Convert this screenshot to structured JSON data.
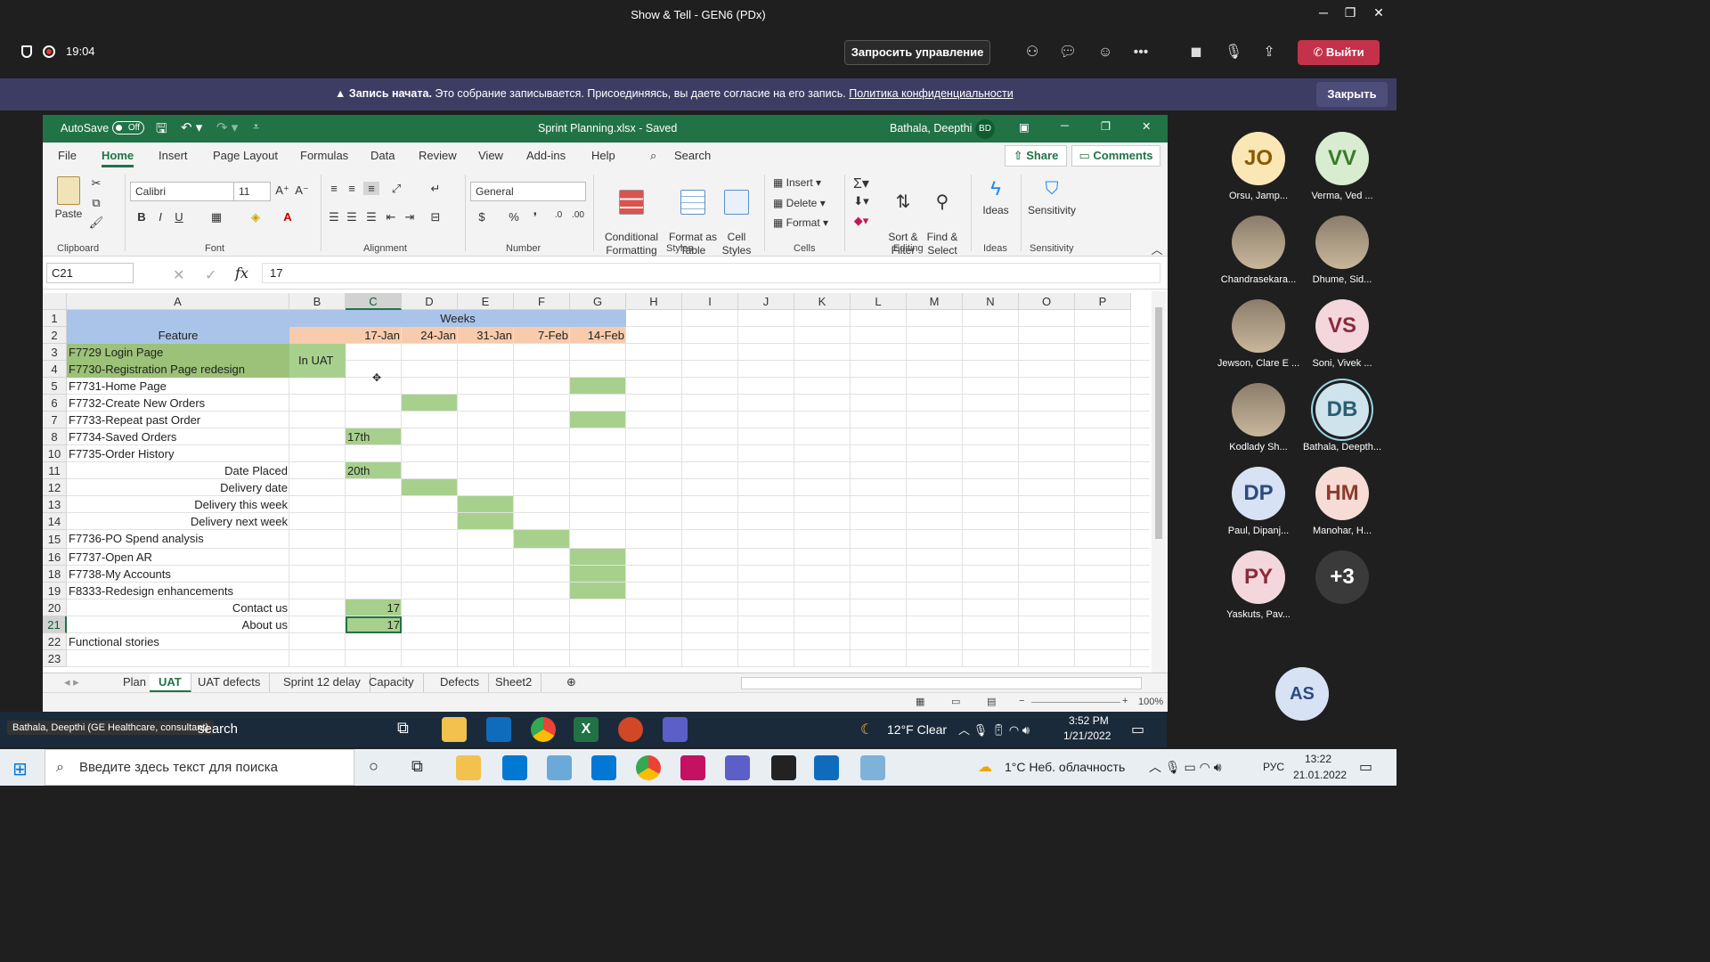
{
  "teams": {
    "meeting_title": "Show & Tell - GEN6 (PDx)",
    "timer": "19:04",
    "request_control": "Запросить управление",
    "leave": "Выйти",
    "notice_bold": "Запись начата.",
    "notice_text": "Это собрание записывается. Присоединяясь, вы даете согласие на его запись.",
    "notice_link": "Политика конфиденциальности",
    "notice_close": "Закрыть",
    "presenter_label": "Bathala, Deepthi (GE Healthcare, consultant)"
  },
  "excel": {
    "autosave": "AutoSave",
    "autosave_state": "Off",
    "file_title": "Sprint Planning.xlsx  -  Saved",
    "user_name": "Bathala, Deepthi",
    "user_initials": "BD",
    "tabs": [
      "File",
      "Home",
      "Insert",
      "Page Layout",
      "Formulas",
      "Data",
      "Review",
      "View",
      "Add-ins",
      "Help"
    ],
    "active_tab": "Home",
    "search": "Search",
    "share": "Share",
    "comments": "Comments",
    "ribbon": {
      "paste": "Paste",
      "clipboard": "Clipboard",
      "font_name": "Calibri",
      "font_size": "11",
      "font": "Font",
      "alignment": "Alignment",
      "number_format": "General",
      "number": "Number",
      "conditional_formatting": "Conditional\nFormatting",
      "format_as_table": "Format as\nTable",
      "cell_styles": "Cell\nStyles",
      "styles": "Styles",
      "insert": "Insert",
      "delete": "Delete",
      "format": "Format",
      "cells": "Cells",
      "sort_filter": "Sort &\nFilter",
      "find_select": "Find &\nSelect",
      "editing": "Editing",
      "ideas": "Ideas",
      "ideas_group": "Ideas",
      "sensitivity": "Sensitivity",
      "sensitivity_group": "Sensitivity"
    },
    "name_box": "C21",
    "formula_value": "17",
    "columns": [
      "A",
      "B",
      "C",
      "D",
      "E",
      "F",
      "G",
      "H",
      "I",
      "J",
      "K",
      "L",
      "M",
      "N",
      "O",
      "P"
    ],
    "selected_column": "C",
    "rows": [
      {
        "n": "1",
        "a": "",
        "a_align": "left",
        "a_fill": "#a9c4e8",
        "b": "",
        "b_fill": "#a9c4e8",
        "c": "",
        "d": "Weeks",
        "e": "",
        "f": "",
        "g": ""
      },
      {
        "n": "2",
        "a": "Feature",
        "a_align": "center",
        "a_fill": "#a9c4e8",
        "b": "",
        "b_fill": "#f8cbad",
        "c": "17-Jan",
        "d": "24-Jan",
        "e": "31-Jan",
        "f": "7-Feb",
        "g": "14-Feb"
      },
      {
        "n": "3",
        "a": "F7729 Login Page",
        "a_align": "left",
        "a_fill": "#9bc278",
        "b": "In UAT",
        "b_fill": "#a8d08d",
        "c": "",
        "d": "",
        "e": "",
        "f": "",
        "g": ""
      },
      {
        "n": "4",
        "a": "F7730-Registration Page redesign",
        "a_align": "left",
        "a_fill": "#9bc278",
        "b": "",
        "b_fill": "#a8d08d",
        "c": "",
        "d": "",
        "e": "",
        "f": "",
        "g": ""
      },
      {
        "n": "5",
        "a": "F7731-Home Page",
        "a_align": "left",
        "a_fill": "",
        "b": "",
        "b_fill": "",
        "c": "",
        "d": "",
        "e": "",
        "f": "",
        "g": ""
      },
      {
        "n": "6",
        "a": "F7732-Create New Orders",
        "a_align": "left",
        "a_fill": "",
        "b": "",
        "b_fill": "",
        "c": "",
        "d": "",
        "e": "",
        "f": "",
        "g": ""
      },
      {
        "n": "7",
        "a": "F7733-Repeat past Order",
        "a_align": "left",
        "a_fill": "",
        "b": "",
        "b_fill": "",
        "c": "",
        "d": "",
        "e": "",
        "f": "",
        "g": ""
      },
      {
        "n": "8",
        "a": "F7734-Saved Orders",
        "a_align": "left",
        "a_fill": "",
        "b": "",
        "b_fill": "",
        "c": "17th",
        "d": "",
        "e": "",
        "f": "",
        "g": ""
      },
      {
        "n": "10",
        "a": "F7735-Order History",
        "a_align": "left",
        "a_fill": "",
        "b": "",
        "b_fill": "",
        "c": "",
        "d": "",
        "e": "",
        "f": "",
        "g": ""
      },
      {
        "n": "11",
        "a": "Date Placed",
        "a_align": "right",
        "a_fill": "",
        "b": "",
        "b_fill": "",
        "c": "20th",
        "d": "",
        "e": "",
        "f": "",
        "g": ""
      },
      {
        "n": "12",
        "a": "Delivery date",
        "a_align": "right",
        "a_fill": "",
        "b": "",
        "b_fill": "",
        "c": "",
        "d": "",
        "e": "",
        "f": "",
        "g": ""
      },
      {
        "n": "13",
        "a": "Delivery this week",
        "a_align": "right",
        "a_fill": "",
        "b": "",
        "b_fill": "",
        "c": "",
        "d": "",
        "e": "",
        "f": "",
        "g": ""
      },
      {
        "n": "14",
        "a": "Delivery next week",
        "a_align": "right",
        "a_fill": "",
        "b": "",
        "b_fill": "",
        "c": "",
        "d": "",
        "e": "",
        "f": "",
        "g": ""
      },
      {
        "n": "15",
        "a": "F7736-PO Spend analysis",
        "a_align": "left",
        "a_fill": "",
        "b": "",
        "b_fill": "",
        "c": "",
        "d": "",
        "e": "",
        "f": "",
        "g": ""
      },
      {
        "n": "16",
        "a": "F7737-Open AR",
        "a_align": "left",
        "a_fill": "",
        "b": "",
        "b_fill": "",
        "c": "",
        "d": "",
        "e": "",
        "f": "",
        "g": ""
      },
      {
        "n": "18",
        "a": "F7738-My Accounts",
        "a_align": "left",
        "a_fill": "",
        "b": "",
        "b_fill": "",
        "c": "",
        "d": "",
        "e": "",
        "f": "",
        "g": ""
      },
      {
        "n": "19",
        "a": "F8333-Redesign enhancements",
        "a_align": "left",
        "a_fill": "",
        "b": "",
        "b_fill": "",
        "c": "",
        "d": "",
        "e": "",
        "f": "",
        "g": ""
      },
      {
        "n": "20",
        "a": "Contact us",
        "a_align": "right",
        "a_fill": "",
        "b": "",
        "b_fill": "",
        "c": "17",
        "d": "",
        "e": "",
        "f": "",
        "g": ""
      },
      {
        "n": "21",
        "a": "About us",
        "a_align": "right",
        "a_fill": "",
        "b": "",
        "b_fill": "",
        "c": "17",
        "d": "",
        "e": "",
        "f": "",
        "g": ""
      },
      {
        "n": "22",
        "a": "Functional stories",
        "a_align": "left",
        "a_fill": "",
        "b": "",
        "b_fill": "",
        "c": "",
        "d": "",
        "e": "",
        "f": "",
        "g": ""
      },
      {
        "n": "23",
        "a": "",
        "a_align": "left",
        "a_fill": "",
        "b": "",
        "b_fill": "",
        "c": "",
        "d": "",
        "e": "",
        "f": "",
        "g": ""
      }
    ],
    "green_fills": [
      {
        "row": "5",
        "col": "G"
      },
      {
        "row": "6",
        "col": "D"
      },
      {
        "row": "7",
        "col": "G"
      },
      {
        "row": "8",
        "col": "C"
      },
      {
        "row": "11",
        "col": "C"
      },
      {
        "row": "12",
        "col": "D"
      },
      {
        "row": "13",
        "col": "E"
      },
      {
        "row": "14",
        "col": "E"
      },
      {
        "row": "15",
        "col": "F"
      },
      {
        "row": "16",
        "col": "G"
      },
      {
        "row": "18",
        "col": "G"
      },
      {
        "row": "19",
        "col": "G"
      },
      {
        "row": "20",
        "col": "C"
      },
      {
        "row": "21",
        "col": "C"
      }
    ],
    "sheet_tabs": [
      "Plan",
      "UAT",
      "UAT defects",
      "Sprint 12 delay",
      "Capacity",
      "Defects",
      "Sheet2"
    ],
    "active_sheet": "UAT",
    "zoom": "100%"
  },
  "inner_taskbar": {
    "search": "search",
    "weather": "12°F  Clear",
    "time": "3:52 PM",
    "date": "1/21/2022"
  },
  "os_taskbar": {
    "search_placeholder": "Введите здесь текст для поиска",
    "weather": "1°C  Неб. облачность",
    "lang": "РУС",
    "time": "13:22",
    "date": "21.01.2022"
  },
  "participants": [
    {
      "initials": "JO",
      "name": "Orsu, Jamp...",
      "bg": "#fbe7b5",
      "fg": "#8a5a00",
      "photo": false
    },
    {
      "initials": "VV",
      "name": "Verma, Ved ...",
      "bg": "#d8ecd0",
      "fg": "#3b7a2a",
      "photo": false
    },
    {
      "initials": "",
      "name": "Chandrasekara...",
      "bg": "#cfcfcf",
      "fg": "#000",
      "photo": true
    },
    {
      "initials": "",
      "name": "Dhume, Sid...",
      "bg": "#cfcfcf",
      "fg": "#000",
      "photo": true
    },
    {
      "initials": "",
      "name": "Jewson, Clare E ...",
      "bg": "#cfcfcf",
      "fg": "#000",
      "photo": true
    },
    {
      "initials": "VS",
      "name": "Soni, Vivek ...",
      "bg": "#f4d7dc",
      "fg": "#8a2b3c",
      "photo": false
    },
    {
      "initials": "",
      "name": "Kodlady Sh...",
      "bg": "#cfcfcf",
      "fg": "#000",
      "photo": true
    },
    {
      "initials": "DB",
      "name": "Bathala, Deepth...",
      "bg": "#cfe3ec",
      "fg": "#2b5d73",
      "photo": false
    },
    {
      "initials": "DP",
      "name": "Paul, Dipanj...",
      "bg": "#d7e2f4",
      "fg": "#2e4a80",
      "photo": false
    },
    {
      "initials": "HM",
      "name": "Manohar, H...",
      "bg": "#f6dcd5",
      "fg": "#8c3b2a",
      "photo": false
    },
    {
      "initials": "PY",
      "name": "Yaskuts, Pav...",
      "bg": "#f4d7dc",
      "fg": "#8a2b3c",
      "photo": false
    },
    {
      "initials": "+3",
      "name": "",
      "bg": "#3a3a3a",
      "fg": "#fff",
      "photo": false
    }
  ],
  "self_avatar": "AS"
}
